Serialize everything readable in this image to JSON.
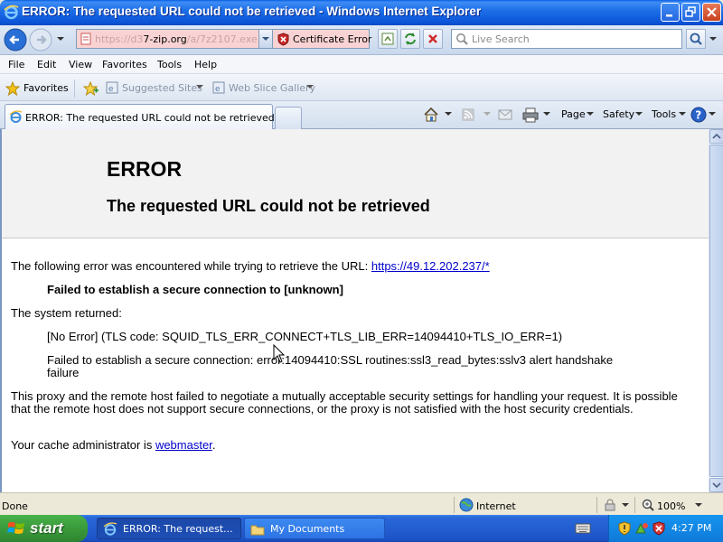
{
  "window": {
    "title": "ERROR: The requested URL could not be retrieved - Windows Internet Explorer"
  },
  "address_bar": {
    "url_prefix": "https://d3",
    "url_host": "7-zip.org",
    "url_suffix": "/a/7z2107.exe",
    "certificate_label": "Certificate Error",
    "address_bg_color": "#f9d3d3"
  },
  "search": {
    "placeholder": "Live Search"
  },
  "menu": [
    "File",
    "Edit",
    "View",
    "Favorites",
    "Tools",
    "Help"
  ],
  "favorites_bar": {
    "favorites_label": "Favorites",
    "suggested_sites": "Suggested Sites",
    "web_slice_gallery": "Web Slice Gallery"
  },
  "tab": {
    "label": "ERROR: The requested URL could not be retrieved"
  },
  "command_bar": {
    "page": "Page",
    "safety": "Safety",
    "tools": "Tools"
  },
  "page": {
    "heading": "ERROR",
    "subheading": "The requested URL could not be retrieved",
    "intro": "The following error was encountered while trying to retrieve the URL: ",
    "error_url": "https://49.12.202.237/*",
    "error_title": "Failed to establish a secure connection to [unknown]",
    "system_returned": "The system returned:",
    "tls_code": "[No Error] (TLS code: SQUID_TLS_ERR_CONNECT+TLS_LIB_ERR=14094410+TLS_IO_ERR=1)",
    "ssl_error": "Failed to establish a secure connection: error:14094410:SSL routines:ssl3_read_bytes:sslv3 alert handshake failure",
    "explanation": "This proxy and the remote host failed to negotiate a mutually acceptable security settings for handling your request. It is possible that the remote host does not support secure connections, or the proxy is not satisfied with the host security credentials.",
    "admin_prefix": "Your cache administrator is ",
    "admin_link": "webmaster",
    "admin_suffix": "."
  },
  "status_bar": {
    "status": "Done",
    "zone": "Internet",
    "zoom": "100%"
  },
  "taskbar": {
    "start_label": "start",
    "tasks": [
      {
        "label": "ERROR: The request...",
        "active": true
      },
      {
        "label": "My Documents",
        "active": false
      }
    ],
    "clock": "4:27 PM"
  }
}
